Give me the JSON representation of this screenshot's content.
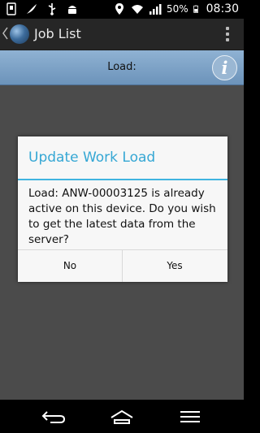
{
  "status_bar": {
    "battery_percent": "50%",
    "time": "08:30",
    "icons": [
      "usb-debug-icon",
      "feather-icon",
      "usb-icon",
      "android-icon",
      "location-icon",
      "wifi-icon",
      "signal-icon",
      "battery-icon"
    ]
  },
  "app_bar": {
    "title": "Job List"
  },
  "load_bar": {
    "label": "Load:"
  },
  "dialog": {
    "title": "Update Work Load",
    "message": "Load: ANW-00003125 is already active on this device. Do you wish to get the latest data from the server?",
    "no_label": "No",
    "yes_label": "Yes",
    "accent_color": "#35a7d4"
  },
  "nav_bar": {
    "buttons": [
      "back-icon",
      "home-icon",
      "recent-apps-icon"
    ]
  }
}
